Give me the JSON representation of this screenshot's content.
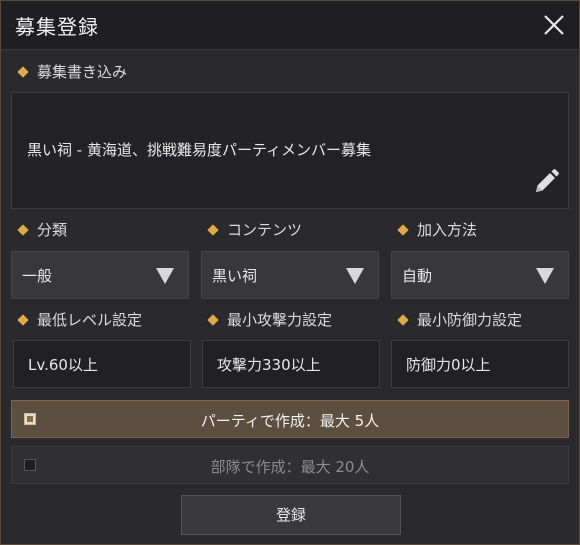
{
  "dialog": {
    "title": "募集登録"
  },
  "post": {
    "label": "募集書き込み",
    "text": "黒い祠 - 黄海道、挑戦難易度パーティメンバー募集"
  },
  "category": {
    "label": "分類",
    "value": "一般"
  },
  "content": {
    "label": "コンテンツ",
    "value": "黒い祠"
  },
  "join_method": {
    "label": "加入方法",
    "value": "自動"
  },
  "min_level": {
    "label": "最低レベル設定",
    "value": "Lv.60以上"
  },
  "min_attack": {
    "label": "最小攻撃力設定",
    "value": "攻撃力330以上"
  },
  "min_defense": {
    "label": "最小防御力設定",
    "value": "防御力0以上"
  },
  "options": {
    "party": {
      "label": "パーティで作成：最大 5人",
      "checked": true
    },
    "squad": {
      "label": "部隊で作成：最大 20人",
      "checked": false
    }
  },
  "register_label": "登録",
  "colors": {
    "accent": "#e1a947",
    "active_row": "#5d4f40",
    "background": "#2a2a2c"
  },
  "icons": {
    "close": "close-icon",
    "edit": "pencil-icon",
    "dropdown": "dropdown-arrow-icon"
  }
}
